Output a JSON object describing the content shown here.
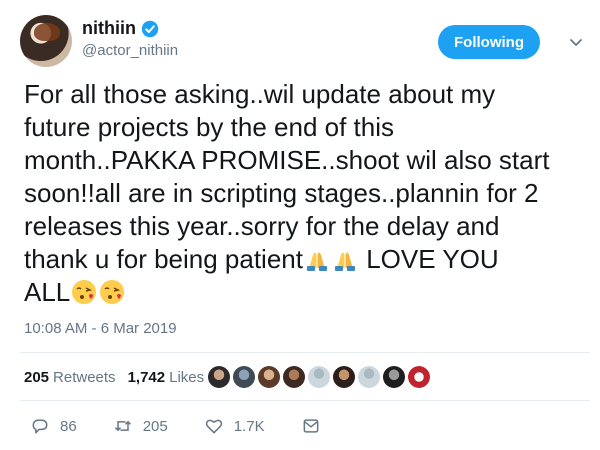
{
  "user": {
    "display_name": "nithiin",
    "handle": "@actor_nithiin",
    "verified": true
  },
  "follow_button": {
    "label": "Following"
  },
  "tweet": {
    "text_lines": [
      "For all those asking..wil update about my",
      "future projects by the end of this",
      "month..PAKKA PROMISE..shoot wil also start",
      "soon!!all are in scripting stages..plannin for 2",
      "releases this year..sorry for the delay and",
      "thank u for being patient",
      "LOVE YOU",
      "ALL"
    ],
    "timestamp": "10:08 AM - 6 Mar 2019"
  },
  "stats": {
    "retweets_count": "205",
    "retweets_label": "Retweets",
    "likes_count": "1,742",
    "likes_label": "Likes"
  },
  "actions": {
    "replies": "86",
    "retweets": "205",
    "likes": "1.7K"
  },
  "colors": {
    "accent": "#1da1f2",
    "muted": "#657786",
    "text": "#14171a"
  },
  "icons": {
    "verified": "verified-badge-icon",
    "chevron": "chevron-down-icon",
    "reply": "reply-icon",
    "retweet": "retweet-icon",
    "like": "heart-icon",
    "dm": "envelope-icon",
    "folded_hands": "folded-hands-emoji",
    "kiss": "face-blowing-kiss-emoji"
  }
}
